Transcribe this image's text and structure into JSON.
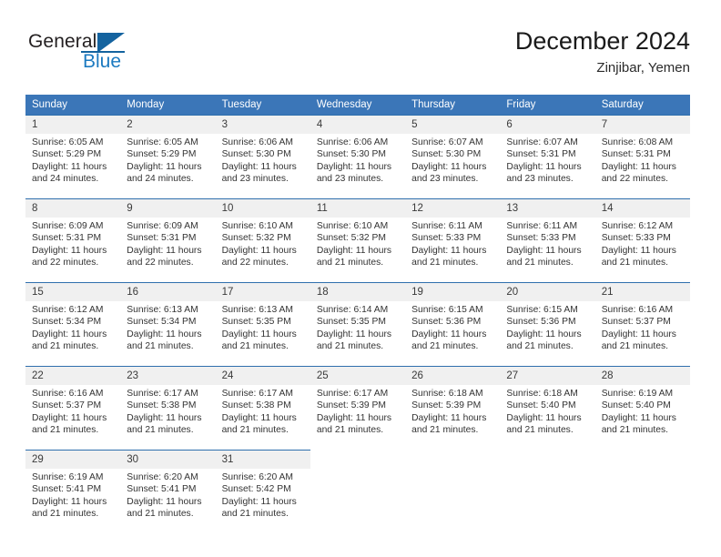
{
  "brand": {
    "name_part1": "General",
    "name_part2": "Blue",
    "logo_icon": "triangle-flag-icon"
  },
  "header": {
    "title": "December 2024",
    "subtitle": "Zinjibar, Yemen"
  },
  "calendar": {
    "weekday_headers": [
      "Sunday",
      "Monday",
      "Tuesday",
      "Wednesday",
      "Thursday",
      "Friday",
      "Saturday"
    ],
    "accent_color": "#3b76b8",
    "daynum_background": "#f0f0f0",
    "weeks": [
      [
        {
          "day": "1",
          "sunrise": "Sunrise: 6:05 AM",
          "sunset": "Sunset: 5:29 PM",
          "daylight": "Daylight: 11 hours and 24 minutes."
        },
        {
          "day": "2",
          "sunrise": "Sunrise: 6:05 AM",
          "sunset": "Sunset: 5:29 PM",
          "daylight": "Daylight: 11 hours and 24 minutes."
        },
        {
          "day": "3",
          "sunrise": "Sunrise: 6:06 AM",
          "sunset": "Sunset: 5:30 PM",
          "daylight": "Daylight: 11 hours and 23 minutes."
        },
        {
          "day": "4",
          "sunrise": "Sunrise: 6:06 AM",
          "sunset": "Sunset: 5:30 PM",
          "daylight": "Daylight: 11 hours and 23 minutes."
        },
        {
          "day": "5",
          "sunrise": "Sunrise: 6:07 AM",
          "sunset": "Sunset: 5:30 PM",
          "daylight": "Daylight: 11 hours and 23 minutes."
        },
        {
          "day": "6",
          "sunrise": "Sunrise: 6:07 AM",
          "sunset": "Sunset: 5:31 PM",
          "daylight": "Daylight: 11 hours and 23 minutes."
        },
        {
          "day": "7",
          "sunrise": "Sunrise: 6:08 AM",
          "sunset": "Sunset: 5:31 PM",
          "daylight": "Daylight: 11 hours and 22 minutes."
        }
      ],
      [
        {
          "day": "8",
          "sunrise": "Sunrise: 6:09 AM",
          "sunset": "Sunset: 5:31 PM",
          "daylight": "Daylight: 11 hours and 22 minutes."
        },
        {
          "day": "9",
          "sunrise": "Sunrise: 6:09 AM",
          "sunset": "Sunset: 5:31 PM",
          "daylight": "Daylight: 11 hours and 22 minutes."
        },
        {
          "day": "10",
          "sunrise": "Sunrise: 6:10 AM",
          "sunset": "Sunset: 5:32 PM",
          "daylight": "Daylight: 11 hours and 22 minutes."
        },
        {
          "day": "11",
          "sunrise": "Sunrise: 6:10 AM",
          "sunset": "Sunset: 5:32 PM",
          "daylight": "Daylight: 11 hours and 21 minutes."
        },
        {
          "day": "12",
          "sunrise": "Sunrise: 6:11 AM",
          "sunset": "Sunset: 5:33 PM",
          "daylight": "Daylight: 11 hours and 21 minutes."
        },
        {
          "day": "13",
          "sunrise": "Sunrise: 6:11 AM",
          "sunset": "Sunset: 5:33 PM",
          "daylight": "Daylight: 11 hours and 21 minutes."
        },
        {
          "day": "14",
          "sunrise": "Sunrise: 6:12 AM",
          "sunset": "Sunset: 5:33 PM",
          "daylight": "Daylight: 11 hours and 21 minutes."
        }
      ],
      [
        {
          "day": "15",
          "sunrise": "Sunrise: 6:12 AM",
          "sunset": "Sunset: 5:34 PM",
          "daylight": "Daylight: 11 hours and 21 minutes."
        },
        {
          "day": "16",
          "sunrise": "Sunrise: 6:13 AM",
          "sunset": "Sunset: 5:34 PM",
          "daylight": "Daylight: 11 hours and 21 minutes."
        },
        {
          "day": "17",
          "sunrise": "Sunrise: 6:13 AM",
          "sunset": "Sunset: 5:35 PM",
          "daylight": "Daylight: 11 hours and 21 minutes."
        },
        {
          "day": "18",
          "sunrise": "Sunrise: 6:14 AM",
          "sunset": "Sunset: 5:35 PM",
          "daylight": "Daylight: 11 hours and 21 minutes."
        },
        {
          "day": "19",
          "sunrise": "Sunrise: 6:15 AM",
          "sunset": "Sunset: 5:36 PM",
          "daylight": "Daylight: 11 hours and 21 minutes."
        },
        {
          "day": "20",
          "sunrise": "Sunrise: 6:15 AM",
          "sunset": "Sunset: 5:36 PM",
          "daylight": "Daylight: 11 hours and 21 minutes."
        },
        {
          "day": "21",
          "sunrise": "Sunrise: 6:16 AM",
          "sunset": "Sunset: 5:37 PM",
          "daylight": "Daylight: 11 hours and 21 minutes."
        }
      ],
      [
        {
          "day": "22",
          "sunrise": "Sunrise: 6:16 AM",
          "sunset": "Sunset: 5:37 PM",
          "daylight": "Daylight: 11 hours and 21 minutes."
        },
        {
          "day": "23",
          "sunrise": "Sunrise: 6:17 AM",
          "sunset": "Sunset: 5:38 PM",
          "daylight": "Daylight: 11 hours and 21 minutes."
        },
        {
          "day": "24",
          "sunrise": "Sunrise: 6:17 AM",
          "sunset": "Sunset: 5:38 PM",
          "daylight": "Daylight: 11 hours and 21 minutes."
        },
        {
          "day": "25",
          "sunrise": "Sunrise: 6:17 AM",
          "sunset": "Sunset: 5:39 PM",
          "daylight": "Daylight: 11 hours and 21 minutes."
        },
        {
          "day": "26",
          "sunrise": "Sunrise: 6:18 AM",
          "sunset": "Sunset: 5:39 PM",
          "daylight": "Daylight: 11 hours and 21 minutes."
        },
        {
          "day": "27",
          "sunrise": "Sunrise: 6:18 AM",
          "sunset": "Sunset: 5:40 PM",
          "daylight": "Daylight: 11 hours and 21 minutes."
        },
        {
          "day": "28",
          "sunrise": "Sunrise: 6:19 AM",
          "sunset": "Sunset: 5:40 PM",
          "daylight": "Daylight: 11 hours and 21 minutes."
        }
      ],
      [
        {
          "day": "29",
          "sunrise": "Sunrise: 6:19 AM",
          "sunset": "Sunset: 5:41 PM",
          "daylight": "Daylight: 11 hours and 21 minutes."
        },
        {
          "day": "30",
          "sunrise": "Sunrise: 6:20 AM",
          "sunset": "Sunset: 5:41 PM",
          "daylight": "Daylight: 11 hours and 21 minutes."
        },
        {
          "day": "31",
          "sunrise": "Sunrise: 6:20 AM",
          "sunset": "Sunset: 5:42 PM",
          "daylight": "Daylight: 11 hours and 21 minutes."
        },
        {
          "day": "",
          "sunrise": "",
          "sunset": "",
          "daylight": ""
        },
        {
          "day": "",
          "sunrise": "",
          "sunset": "",
          "daylight": ""
        },
        {
          "day": "",
          "sunrise": "",
          "sunset": "",
          "daylight": ""
        },
        {
          "day": "",
          "sunrise": "",
          "sunset": "",
          "daylight": ""
        }
      ]
    ]
  }
}
